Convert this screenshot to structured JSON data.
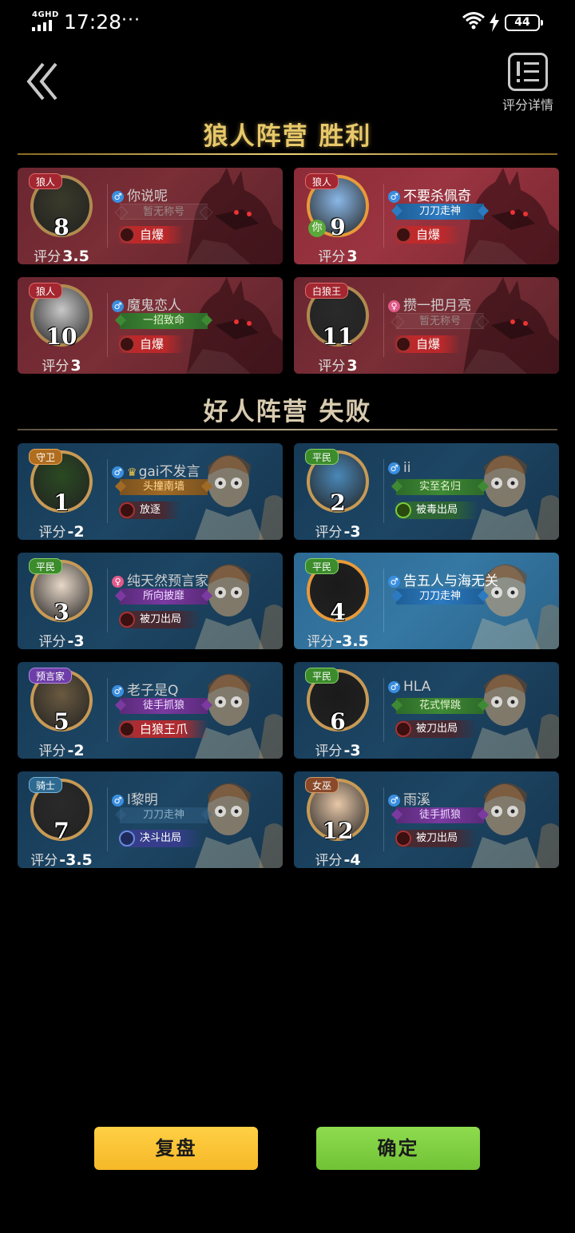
{
  "status_bar": {
    "network": "4GHD",
    "time": "17:28",
    "dots": "···",
    "battery": "44"
  },
  "header": {
    "back_icon": "double-chevron-left-icon",
    "detail_label": "评分详情",
    "detail_icon": "list-icon"
  },
  "sections": {
    "werewolf_title": "狼人阵营  胜利",
    "good_title": "好人阵营  失败"
  },
  "score_label": "评分",
  "wolf_players": [
    {
      "role": "狼人",
      "seat": "8",
      "name": "你说呢",
      "gender": "♂",
      "title": "暂无称号",
      "outcome": "自爆",
      "score": "3.5"
    },
    {
      "role": "狼人",
      "seat": "9",
      "name": "不要杀佩奇",
      "gender": "♂",
      "title": "刀刀走神",
      "outcome": "自爆",
      "score": "3",
      "you": "你"
    },
    {
      "role": "狼人",
      "seat": "10",
      "name": "魔鬼恋人",
      "gender": "♂",
      "title": "一招致命",
      "outcome": "自爆",
      "score": "3"
    },
    {
      "role": "白狼王",
      "seat": "11",
      "name": "攒一把月亮",
      "gender": "♀",
      "title": "暂无称号",
      "outcome": "自爆",
      "score": "3"
    }
  ],
  "good_players": [
    {
      "role": "守卫",
      "seat": "1",
      "name": "gai不发言",
      "gender": "♂",
      "title": "头撞南墙",
      "outcome": "放逐",
      "score": "-2"
    },
    {
      "role": "平民",
      "seat": "2",
      "name": "ii",
      "gender": "♂",
      "title": "实至名归",
      "outcome": "被毒出局",
      "score": "-3"
    },
    {
      "role": "平民",
      "seat": "3",
      "name": "纯天然预言家",
      "gender": "♀",
      "title": "所向披靡",
      "outcome": "被刀出局",
      "score": "-3"
    },
    {
      "role": "平民",
      "seat": "4",
      "name": "告五人与海无关",
      "gender": "♂",
      "title": "刀刀走神",
      "outcome": "",
      "score": "-3.5"
    },
    {
      "role": "预言家",
      "seat": "5",
      "name": "老子是Q",
      "gender": "♂",
      "title": "徒手抓狼",
      "outcome": "白狼王爪",
      "score": "-2"
    },
    {
      "role": "平民",
      "seat": "6",
      "name": "HLA",
      "gender": "♂",
      "title": "花式悍跳",
      "outcome": "被刀出局",
      "score": "-3"
    },
    {
      "role": "骑士",
      "seat": "7",
      "name": "l黎明",
      "gender": "♂",
      "title": "刀刀走神",
      "outcome": "决斗出局",
      "score": "-3.5"
    },
    {
      "role": "女巫",
      "seat": "12",
      "name": "雨溪",
      "gender": "♂",
      "title": "徒手抓狼",
      "outcome": "被刀出局",
      "score": "-4"
    }
  ],
  "buttons": {
    "replay": "复盘",
    "confirm": "确定"
  }
}
